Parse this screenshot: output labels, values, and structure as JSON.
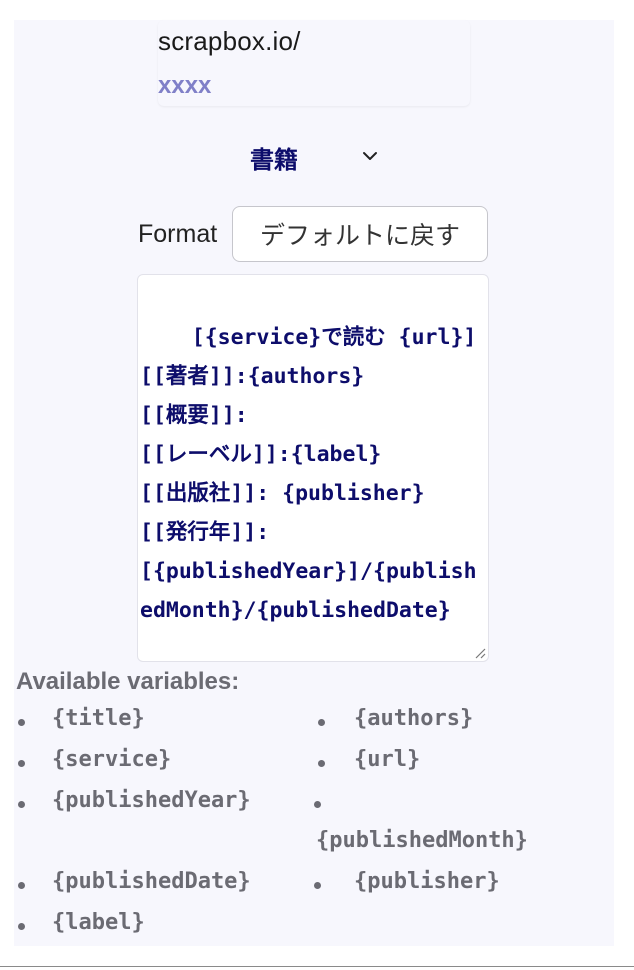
{
  "project": {
    "prefix": "scrapbox.io/",
    "name": "xxxx"
  },
  "type_select": {
    "selected": "書籍",
    "icon": "chevron-down-icon"
  },
  "format": {
    "label": "Format",
    "reset_label": "デフォルトに戻す",
    "template": "[{service}で読む {url}]\n[[著者]]:{authors}\n[[概要]]:\n[[レーベル]]:{label}\n[[出版社]]: {publisher}\n[[発行年]]:\n[{publishedYear}]/{publishedMonth}/{publishedDate}"
  },
  "variables": {
    "title": "Available variables:",
    "items": [
      "{title}",
      "{authors}",
      "{service}",
      "{url}",
      "{publishedYear}",
      "{publishedMonth}",
      "{publishedDate}",
      "{publisher}",
      "{label}"
    ]
  },
  "colors": {
    "accent": "#0d0d6b",
    "project_name": "#8080c8",
    "muted": "#6b6b73",
    "panel_bg": "#f7f7fd"
  }
}
